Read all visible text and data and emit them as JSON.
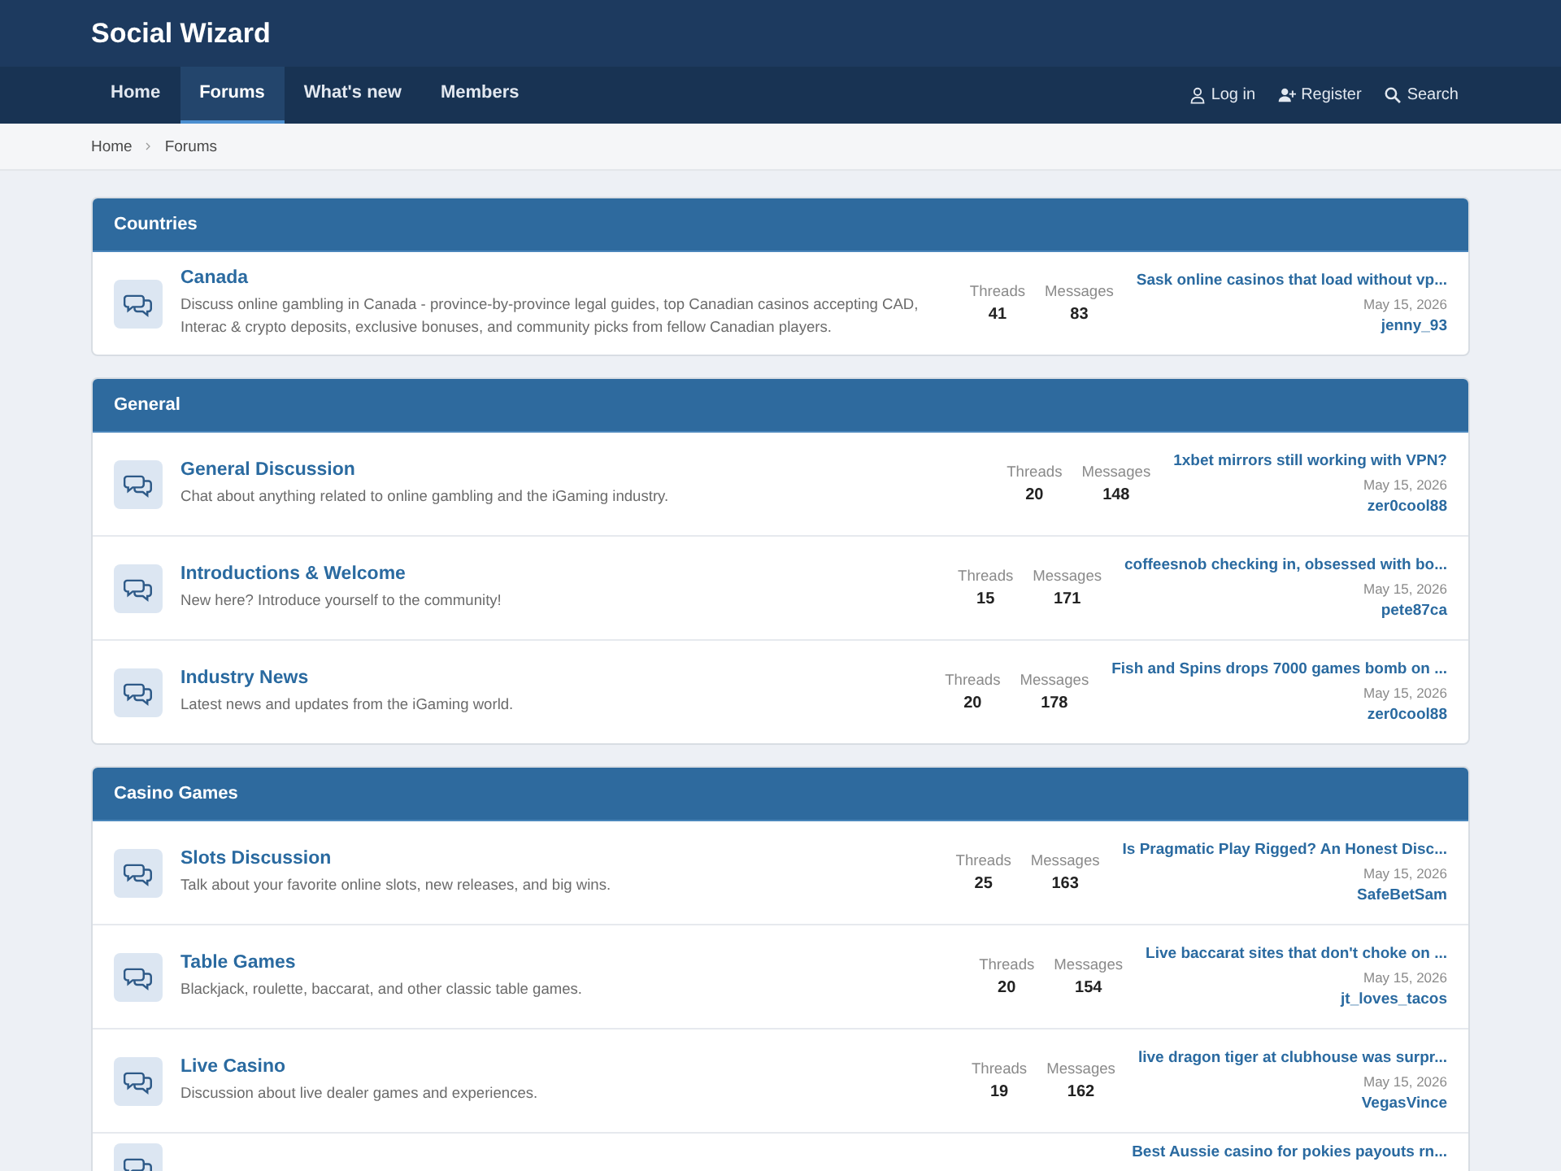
{
  "site_title": "Social Wizard",
  "nav": [
    {
      "label": "Home",
      "selected": false
    },
    {
      "label": "Forums",
      "selected": true
    },
    {
      "label": "What's new",
      "selected": false
    },
    {
      "label": "Members",
      "selected": false
    }
  ],
  "account_links": [
    {
      "kind": "login",
      "label": "Log in"
    },
    {
      "kind": "register",
      "label": "Register"
    },
    {
      "kind": "search",
      "label": "Search"
    }
  ],
  "breadcrumb": [
    "Home",
    "Forums"
  ],
  "categories": [
    {
      "title": "Countries",
      "forums": [
        {
          "title": "Canada",
          "description": "Discuss online gambling in Canada - province-by-province legal guides, top Canadian casinos accepting CAD, Interac & crypto deposits, exclusive bonuses, and community picks from fellow Canadian players.",
          "threads_label": "Threads",
          "threads": "41",
          "messages_label": "Messages",
          "messages": "83",
          "latest_title": "Sask online casinos that load without vp...",
          "latest_date": "May 15, 2026",
          "latest_user": "jenny_93"
        }
      ]
    },
    {
      "title": "General",
      "forums": [
        {
          "title": "General Discussion",
          "description": "Chat about anything related to online gambling and the iGaming industry.",
          "threads_label": "Threads",
          "threads": "20",
          "messages_label": "Messages",
          "messages": "148",
          "latest_title": "1xbet mirrors still working with VPN?",
          "latest_date": "May 15, 2026",
          "latest_user": "zer0cool88"
        },
        {
          "title": "Introductions & Welcome",
          "description": "New here? Introduce yourself to the community!",
          "threads_label": "Threads",
          "threads": "15",
          "messages_label": "Messages",
          "messages": "171",
          "latest_title": "coffeesnob checking in, obsessed with bo...",
          "latest_date": "May 15, 2026",
          "latest_user": "pete87ca"
        },
        {
          "title": "Industry News",
          "description": "Latest news and updates from the iGaming world.",
          "threads_label": "Threads",
          "threads": "20",
          "messages_label": "Messages",
          "messages": "178",
          "latest_title": "Fish and Spins drops 7000 games bomb on ...",
          "latest_date": "May 15, 2026",
          "latest_user": "zer0cool88"
        }
      ]
    },
    {
      "title": "Casino Games",
      "forums": [
        {
          "title": "Slots Discussion",
          "description": "Talk about your favorite online slots, new releases, and big wins.",
          "threads_label": "Threads",
          "threads": "25",
          "messages_label": "Messages",
          "messages": "163",
          "latest_title": "Is Pragmatic Play Rigged? An Honest Disc...",
          "latest_date": "May 15, 2026",
          "latest_user": "SafeBetSam"
        },
        {
          "title": "Table Games",
          "description": "Blackjack, roulette, baccarat, and other classic table games.",
          "threads_label": "Threads",
          "threads": "20",
          "messages_label": "Messages",
          "messages": "154",
          "latest_title": "Live baccarat sites that don't choke on ...",
          "latest_date": "May 15, 2026",
          "latest_user": "jt_loves_tacos"
        },
        {
          "title": "Live Casino",
          "description": "Discussion about live dealer games and experiences.",
          "threads_label": "Threads",
          "threads": "19",
          "messages_label": "Messages",
          "messages": "162",
          "latest_title": "live dragon tiger at clubhouse was surpr...",
          "latest_date": "May 15, 2026",
          "latest_user": "VegasVince"
        },
        {
          "latest_title": "Best Aussie casino for pokies payouts rn..."
        }
      ]
    }
  ]
}
